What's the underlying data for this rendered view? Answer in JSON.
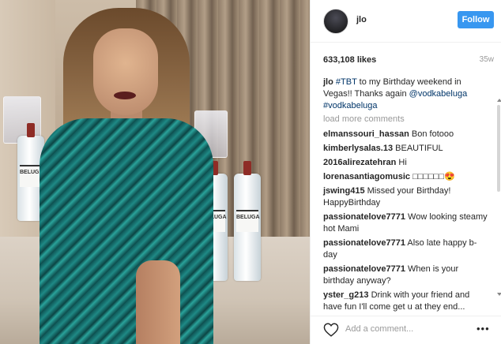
{
  "post": {
    "username": "jlo",
    "follow_label": "Follow",
    "likes": "633,108 likes",
    "time_ago": "35w",
    "caption": {
      "user": "jlo",
      "hashtag1": "#TBT",
      "text1": " to my Birthday weekend in Vegas!! Thanks again ",
      "mention": "@vodkabeluga",
      "hashtag2": "#vodkabeluga"
    },
    "load_more": "load more comments",
    "add_comment_placeholder": "Add a comment...",
    "more_icon": "•••",
    "photo_label_text": "BELUGA"
  },
  "comments": [
    {
      "user": "elmanssouri_hassan",
      "text": "Bon fotooo"
    },
    {
      "user": "kimberlysalas.13",
      "text": "BEAUTIFUL"
    },
    {
      "user": "2016alirezatehran",
      "text": "Hi"
    },
    {
      "user": "lorenasantiagomusic",
      "text": "□□□□□□😍"
    },
    {
      "user": "jswing415",
      "text": "Missed your Birthday! HappyBirthday"
    },
    {
      "user": "passionatelove7771",
      "text": "Wow looking steamy hot Mami"
    },
    {
      "user": "passionatelove7771",
      "text": "Also late happy b-day"
    },
    {
      "user": "passionatelove7771",
      "text": "When is your birthday anyway?"
    },
    {
      "user": "yster_g213",
      "text": "Drink with your friend and have fun I'll come get u at they end..."
    }
  ],
  "colors": {
    "follow_button": "#3897f0",
    "link": "#003569",
    "muted": "#999999"
  },
  "icons": [
    "heart-icon",
    "more-options-icon",
    "scroll-up-icon",
    "scroll-down-icon"
  ]
}
